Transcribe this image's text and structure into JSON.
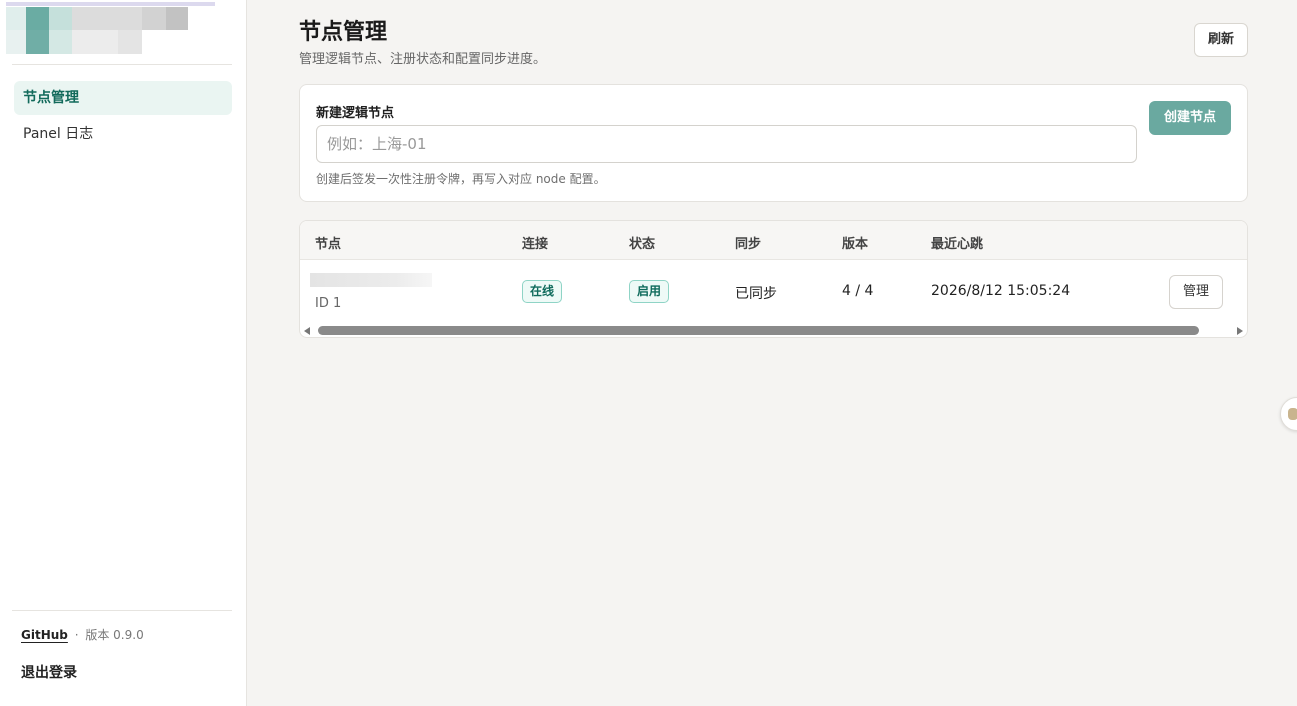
{
  "sidebar": {
    "nav": [
      {
        "label": "节点管理",
        "active": true
      },
      {
        "label": "Panel 日志",
        "active": false
      }
    ],
    "footer": {
      "github_label": "GitHub",
      "separator": "·",
      "version_text": "版本 0.9.0",
      "logout_label": "退出登录"
    }
  },
  "header": {
    "title": "节点管理",
    "subtitle": "管理逻辑节点、注册状态和配置同步进度。",
    "refresh_label": "刷新"
  },
  "create": {
    "label": "新建逻辑节点",
    "input_placeholder": "例如：上海-01",
    "input_value": "",
    "help_text": "创建后签发一次性注册令牌，再写入对应 node 配置。",
    "button_label": "创建节点"
  },
  "table": {
    "columns": [
      "节点",
      "连接",
      "状态",
      "同步",
      "版本",
      "最近心跳"
    ],
    "rows": [
      {
        "id_text": "ID 1",
        "connection": "在线",
        "status": "启用",
        "sync": "已同步",
        "version": "4 / 4",
        "heartbeat": "2026/8/12 15:05:24",
        "action_label": "管理"
      }
    ]
  },
  "colors": {
    "accent": "#6aa9a0",
    "nav_active_bg": "#eaf5f2",
    "nav_active_text": "#126a5b",
    "badge_border": "#8fd4c6",
    "page_bg": "#f5f4f2"
  }
}
